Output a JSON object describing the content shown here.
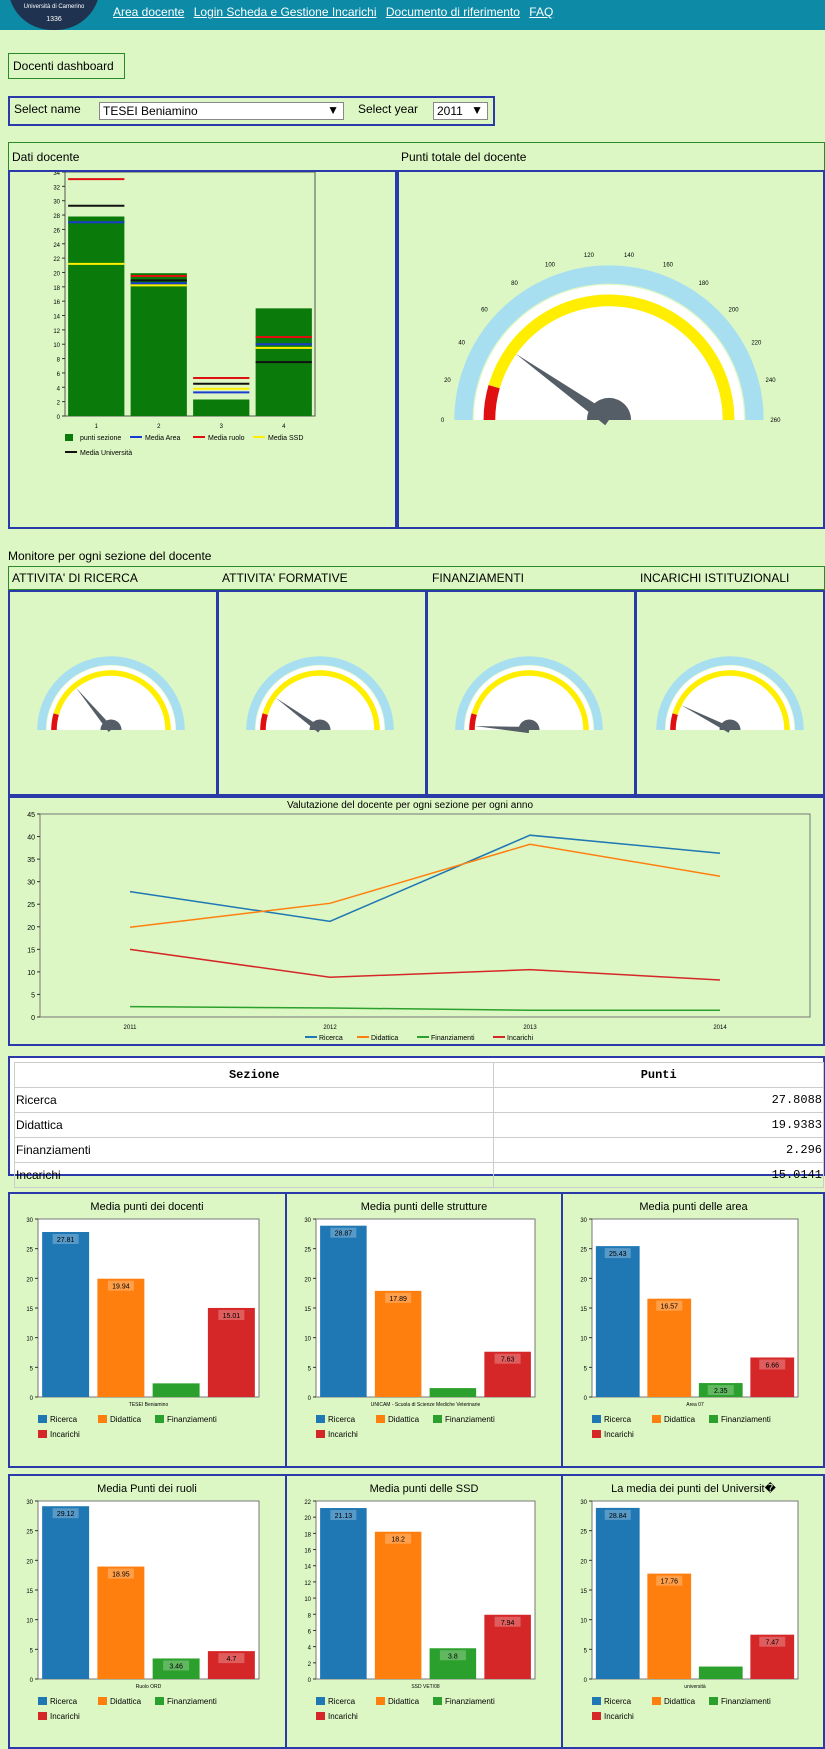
{
  "header": {
    "logo_text": "Università di Camerino",
    "logo_year": "1336",
    "nav": [
      "Area docente",
      "Login Scheda e Gestione Incarichi",
      "Documento di riferimento",
      "FAQ"
    ]
  },
  "dashboard_title": "Docenti dashboard",
  "filters": {
    "name_label": "Select name",
    "name_value": "TESEI Beniamino",
    "year_label": "Select year",
    "year_value": "2011"
  },
  "panels": {
    "dati_docente": "Dati docente",
    "punti_totale": "Punti totale del docente",
    "monitor_title": "Monitore per ogni sezione del docente",
    "sections": [
      "ATTIVITA' DI RICERCA",
      "ATTIVITA' FORMATIVE",
      "FINANZIAMENTI",
      "INCARICHI ISTITUZIONALI"
    ],
    "line_title": "Valutazione del docente per ogni sezione per ogni anno"
  },
  "colors": {
    "ricerca": "#1f77b4",
    "didattica": "#ff7f0e",
    "finanziamenti": "#2ca02c",
    "incarichi": "#d62728",
    "green_bar": "#0a7a0a",
    "gauge_red": "#e01010",
    "gauge_yellow": "#ffee00",
    "gauge_rim": "#a8dff0",
    "needle": "#555e66"
  },
  "table": {
    "headers": [
      "Sezione",
      "Punti"
    ],
    "rows": [
      [
        "Ricerca",
        "27.8088"
      ],
      [
        "Didattica",
        "19.9383"
      ],
      [
        "Finanziamenti",
        "2.296"
      ],
      [
        "Incarichi",
        "15.0141"
      ]
    ]
  },
  "chart_data": [
    {
      "type": "bar",
      "title": "",
      "categories": [
        "1",
        "2",
        "3",
        "4"
      ],
      "ylim": [
        0,
        34
      ],
      "yticks": [
        0,
        2,
        4,
        6,
        8,
        10,
        12,
        14,
        16,
        18,
        20,
        22,
        24,
        26,
        28,
        30,
        32,
        34
      ],
      "series": [
        {
          "name": "punti sezione",
          "values": [
            27.8,
            19.9,
            2.3,
            15.0
          ]
        },
        {
          "name": "Media Area",
          "values": [
            27.0,
            18.5,
            3.3,
            10.0
          ]
        },
        {
          "name": "Media ruolo",
          "values": [
            33.0,
            19.5,
            5.3,
            11.0
          ]
        },
        {
          "name": "Media SSD",
          "values": [
            21.2,
            18.2,
            3.8,
            9.5
          ]
        },
        {
          "name": "Media Università",
          "values": [
            29.3,
            18.9,
            4.5,
            7.5
          ]
        }
      ]
    },
    {
      "type": "gauge",
      "title": "",
      "value": 55,
      "min": 0,
      "max": 280,
      "ticks": [
        "0",
        "20",
        "40",
        "60",
        "80",
        "100",
        "120",
        "140",
        "160",
        "180",
        "200",
        "220",
        "240",
        "260"
      ]
    },
    {
      "type": "gauge",
      "title": "",
      "value": 28,
      "min": 0,
      "max": 100
    },
    {
      "type": "gauge",
      "title": "",
      "value": 20,
      "min": 0,
      "max": 100
    },
    {
      "type": "gauge",
      "title": "",
      "value": 2.3,
      "min": 0,
      "max": 100
    },
    {
      "type": "gauge",
      "title": "",
      "value": 15,
      "min": 0,
      "max": 100
    },
    {
      "type": "line",
      "title": "Valutazione del docente per ogni sezione per ogni anno",
      "x": [
        "2011",
        "2012",
        "2013",
        "2014"
      ],
      "ylim": [
        0,
        45
      ],
      "yticks": [
        0,
        5,
        10,
        15,
        20,
        25,
        30,
        35,
        40,
        45
      ],
      "series": [
        {
          "name": "Ricerca",
          "values": [
            27.8,
            21.2,
            40.3,
            36.3
          ]
        },
        {
          "name": "Didattica",
          "values": [
            19.9,
            25.2,
            38.3,
            31.2
          ]
        },
        {
          "name": "Finanziamenti",
          "values": [
            2.3,
            2.0,
            1.5,
            1.5
          ]
        },
        {
          "name": "Incarichi",
          "values": [
            15.0,
            8.8,
            10.5,
            8.2
          ]
        }
      ]
    },
    {
      "type": "bar",
      "title": "Media punti dei docenti",
      "xlabel": "TESEI Beniamino",
      "ylim": [
        0,
        30
      ],
      "yticks": [
        0,
        5,
        10,
        15,
        20,
        25,
        30
      ],
      "categories": [
        "Ricerca",
        "Didattica",
        "Finanziamenti",
        "Incarichi"
      ],
      "values": [
        27.81,
        19.94,
        2.3,
        15.01
      ],
      "labels": [
        "27.81",
        "19.94",
        "",
        "15.01"
      ]
    },
    {
      "type": "bar",
      "title": "Media punti delle strutture",
      "xlabel": "UNICAM - Scuola di Scienze Mediche Veterinarie",
      "ylim": [
        0,
        30
      ],
      "yticks": [
        0,
        5,
        10,
        15,
        20,
        25,
        30
      ],
      "categories": [
        "Ricerca",
        "Didattica",
        "Finanziamenti",
        "Incarichi"
      ],
      "values": [
        28.87,
        17.89,
        1.5,
        7.63
      ],
      "labels": [
        "28.87",
        "17.89",
        "",
        "7.63"
      ]
    },
    {
      "type": "bar",
      "title": "Media punti delle area",
      "xlabel": "Area 07",
      "ylim": [
        0,
        30
      ],
      "yticks": [
        0,
        5,
        10,
        15,
        20,
        25,
        30
      ],
      "categories": [
        "Ricerca",
        "Didattica",
        "Finanziamenti",
        "Incarichi"
      ],
      "values": [
        25.43,
        16.57,
        2.35,
        6.66
      ],
      "labels": [
        "25.43",
        "16.57",
        "2.35",
        "6.66"
      ]
    },
    {
      "type": "bar",
      "title": "Media Punti dei ruoli",
      "xlabel": "Ruolo ORD",
      "ylim": [
        0,
        30
      ],
      "yticks": [
        0,
        5,
        10,
        15,
        20,
        25,
        30
      ],
      "categories": [
        "Ricerca",
        "Didattica",
        "Finanziamenti",
        "Incarichi"
      ],
      "values": [
        29.12,
        18.95,
        3.46,
        4.7
      ],
      "labels": [
        "29.12",
        "18.95",
        "3.46",
        "4.7"
      ]
    },
    {
      "type": "bar",
      "title": "Media punti delle SSD",
      "xlabel": "SSD VET/08",
      "ylim": [
        0,
        22
      ],
      "yticks": [
        0,
        2,
        4,
        6,
        8,
        10,
        12,
        14,
        16,
        18,
        20,
        22
      ],
      "categories": [
        "Ricerca",
        "Didattica",
        "Finanziamenti",
        "Incarichi"
      ],
      "values": [
        21.13,
        18.2,
        3.8,
        7.94
      ],
      "labels": [
        "21.13",
        "18.2",
        "3.8",
        "7.94"
      ]
    },
    {
      "type": "bar",
      "title": "La media dei punti del Universit�",
      "xlabel": "università",
      "ylim": [
        0,
        30
      ],
      "yticks": [
        0,
        5,
        10,
        15,
        20,
        25,
        30
      ],
      "categories": [
        "Ricerca",
        "Didattica",
        "Finanziamenti",
        "Incarichi"
      ],
      "values": [
        28.84,
        17.76,
        2.1,
        7.47
      ],
      "labels": [
        "28.84",
        "17.76",
        "",
        "7.47"
      ]
    }
  ]
}
